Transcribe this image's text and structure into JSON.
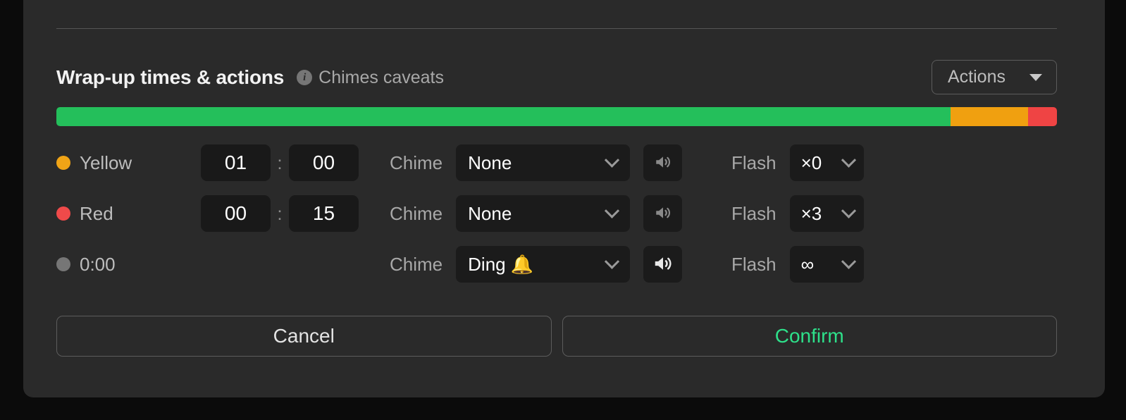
{
  "panel": {
    "title": "Wrap-up times & actions",
    "caveats_label": "Chimes caveats",
    "info_icon": "info-icon",
    "actions_button": {
      "label": "Actions",
      "caret_icon": "triangle-down-icon"
    }
  },
  "progress_bar": {
    "segments": [
      {
        "name": "green",
        "color": "#24bf5b",
        "percent": 89.4
      },
      {
        "name": "orange",
        "color": "#f0a010",
        "percent": 7.7
      },
      {
        "name": "red",
        "color": "#ef4444",
        "percent": 2.9
      }
    ]
  },
  "labels": {
    "chime": "Chime",
    "flash": "Flash",
    "colon": ":"
  },
  "rows": [
    {
      "name": "yellow",
      "dot_color": "#f0a416",
      "label": "Yellow",
      "has_time_inputs": true,
      "minutes": "01",
      "seconds": "00",
      "minutes_placeholder": "00",
      "seconds_placeholder": "00",
      "chime_value": "None",
      "speaker_icon": "speaker-icon",
      "speaker_state": "muted",
      "flash_value": "×0"
    },
    {
      "name": "red",
      "dot_color": "#ef4a4a",
      "label": "Red",
      "has_time_inputs": true,
      "minutes": "00",
      "seconds": "15",
      "minutes_placeholder": "00",
      "seconds_placeholder": "00",
      "chime_value": "None",
      "speaker_icon": "speaker-icon",
      "speaker_state": "muted",
      "flash_value": "×3"
    },
    {
      "name": "zero",
      "dot_color": "#767676",
      "label": "0:00",
      "has_time_inputs": false,
      "minutes": "",
      "seconds": "",
      "minutes_placeholder": "",
      "seconds_placeholder": "",
      "chime_value": "Ding 🔔",
      "speaker_icon": "speaker-icon",
      "speaker_state": "active",
      "flash_value": "∞"
    }
  ],
  "footer": {
    "cancel_label": "Cancel",
    "confirm_label": "Confirm",
    "confirm_color": "#2ee08a"
  }
}
